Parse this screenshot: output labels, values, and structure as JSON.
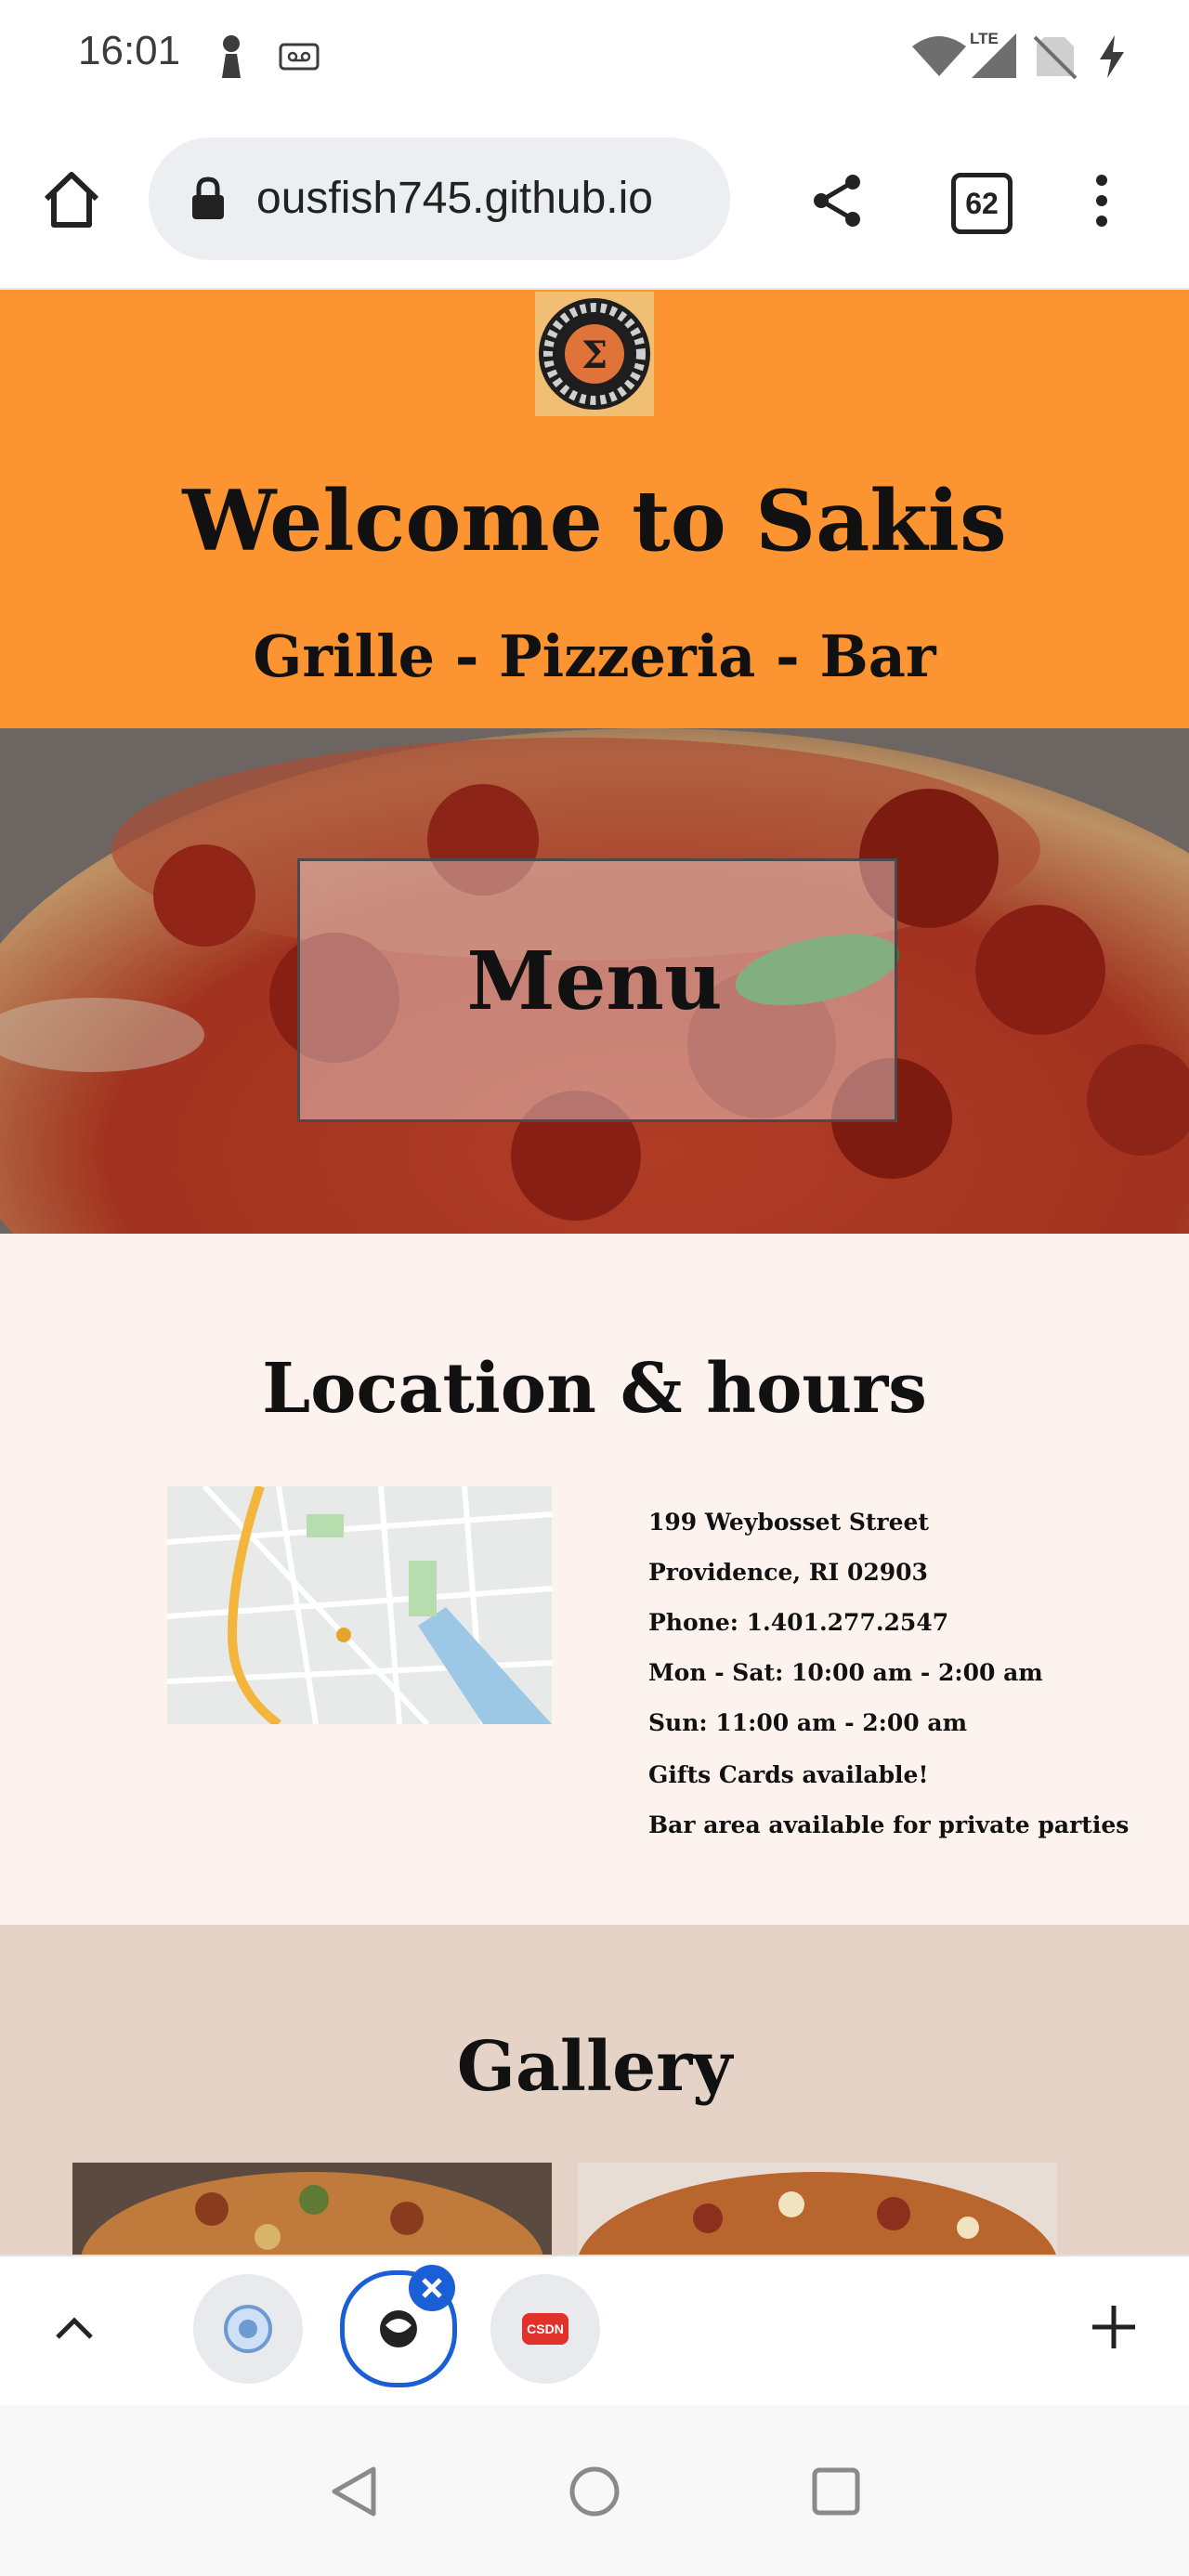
{
  "status_bar": {
    "time": "16:01",
    "network_label": "LTE"
  },
  "browser": {
    "url": "ousfish745.github.io",
    "tab_count": "62"
  },
  "header": {
    "title": "Welcome to Sakis",
    "tagline": "Grille - Pizzeria - Bar",
    "logo_symbol": "Σ"
  },
  "hero": {
    "menu_label": "Menu"
  },
  "location": {
    "title": "Location & hours",
    "lines": [
      "199 Weybosset Street",
      "Providence, RI 02903",
      "Phone: 1.401.277.2547",
      "Mon - Sat: 10:00 am - 2:00 am",
      "Sun: 11:00 am - 2:00 am",
      "Gifts Cards available!",
      "Bar area available for private parties"
    ]
  },
  "gallery": {
    "title": "Gallery"
  },
  "tab_strip": {
    "third_tab_label": "CSDN"
  },
  "colors": {
    "header_orange": "#fd9432",
    "location_bg": "#fdf3ee",
    "gallery_bg": "#e4d3c6",
    "active_tab_ring": "#1a5fd6"
  }
}
